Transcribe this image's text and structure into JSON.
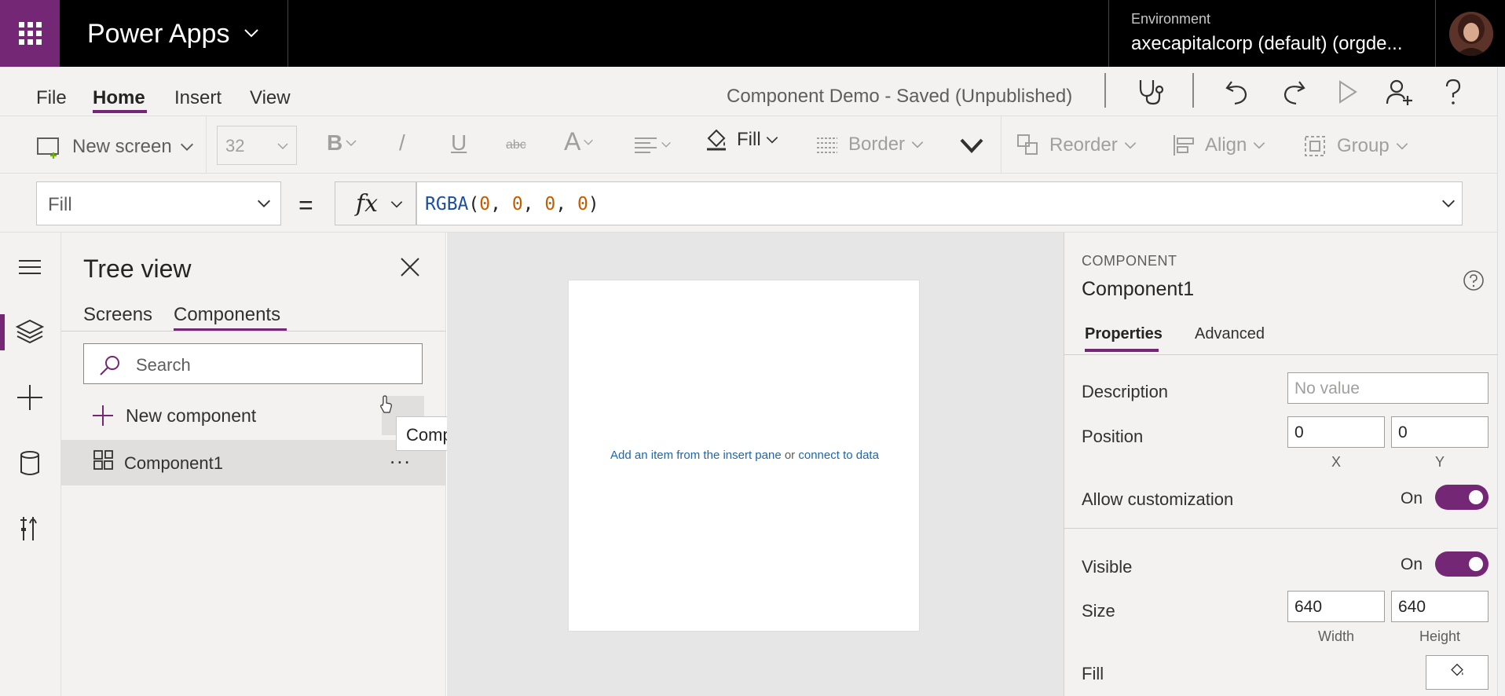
{
  "header": {
    "app_name": "Power Apps",
    "environment_label": "Environment",
    "environment_value": "axecapitalcorp (default) (orgde..."
  },
  "menu": {
    "items": [
      "File",
      "Home",
      "Insert",
      "View"
    ],
    "active": "Home",
    "doc_status": "Component Demo - Saved (Unpublished)"
  },
  "ribbon": {
    "new_screen": "New screen",
    "font_size": "32",
    "bold": "B",
    "italic": "/",
    "underline": "U",
    "strikethrough": "abc",
    "font_color": "A",
    "fill": "Fill",
    "border": "Border",
    "reorder": "Reorder",
    "align": "Align",
    "group": "Group"
  },
  "formula_bar": {
    "property": "Fill",
    "equals": "=",
    "fx": "fx",
    "fn": "RGBA",
    "args": [
      "0",
      "0",
      "0",
      "0"
    ]
  },
  "tree_view": {
    "title": "Tree view",
    "tabs": [
      "Screens",
      "Components"
    ],
    "active_tab": "Components",
    "search_placeholder": "Search",
    "new_component": "New component",
    "items": [
      {
        "label": "Component1",
        "more": "..."
      }
    ],
    "tooltip": "Component options"
  },
  "canvas": {
    "hint_link1": "Add an item from the insert pane",
    "hint_or": "or",
    "hint_link2": "connect to data"
  },
  "properties": {
    "eyebrow": "COMPONENT",
    "name": "Component1",
    "tabs": [
      "Properties",
      "Advanced"
    ],
    "active_tab": "Properties",
    "description_label": "Description",
    "description_placeholder": "No value",
    "position_label": "Position",
    "position_x": "0",
    "position_y": "0",
    "x_caption": "X",
    "y_caption": "Y",
    "allow_customization_label": "Allow customization",
    "allow_customization_value": "On",
    "visible_label": "Visible",
    "visible_value": "On",
    "size_label": "Size",
    "width": "640",
    "height": "640",
    "width_caption": "Width",
    "height_caption": "Height",
    "fill_label": "Fill"
  },
  "colors": {
    "brand": "#742774",
    "header_bg": "#000000",
    "panel_bg": "#f3f2f1",
    "canvas_bg": "#e6e6e6"
  }
}
